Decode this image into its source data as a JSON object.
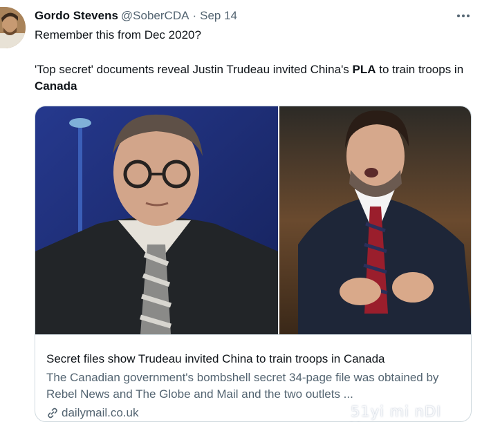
{
  "tweet": {
    "author_name": "Gordo Stevens",
    "author_handle": "@SoberCDA",
    "separator": "·",
    "date": "Sep 14",
    "line1": "Remember this from Dec 2020?",
    "line2_part1": "'Top secret' documents reveal Justin Trudeau invited China's ",
    "line2_bold1": "PLA",
    "line2_part2": " to train troops in ",
    "line2_bold2": "Canada",
    "more_icon": "more-horizontal-icon"
  },
  "card": {
    "title": "Secret files show Trudeau invited China to train troops in Canada",
    "description": "The Canadian government's bombshell secret 34-page file was obtained by Rebel News and The Globe and Mail and the two outlets ...",
    "domain": "dailymail.co.uk",
    "domain_icon": "link-icon"
  },
  "watermark": "51yi mi nDI Y.com",
  "colors": {
    "text_primary": "#0f1419",
    "text_secondary": "#536471",
    "border": "#cfd9de"
  }
}
